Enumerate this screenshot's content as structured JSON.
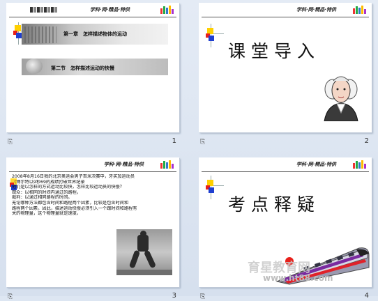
{
  "slides": [
    {
      "number": "1",
      "footer_icon": "⎘",
      "chapter_title": "第一章　怎样描述物体的运动",
      "section_title": "第二节　怎样描述运动的快慢"
    },
    {
      "number": "2",
      "footer_icon": "⎘",
      "title": "课堂导入",
      "image": "portrait-icon"
    },
    {
      "number": "3",
      "footer_icon": "⎘",
      "paragraph_lines": [
        "2008年8月16日我的北京奥运会男子百米决赛中，牙买加运动员",
        "（博尔特以9秒69的成绩打破世界纪录",
        "他们是以怎样的方式运动比较快，怎样比较运动员的快慢？",
        "观众：以相同的时间内通过的路程。",
        "裁判：以通过相同路程的时间。",
        "无论哪种方法都包含时间和路程两个因素，比较是包含时间和",
        "路程两个因素。因此，描述运动快慢必须引入一个跟时间和路程有",
        "关的物理量，这个物理量就是速度。"
      ],
      "image": "sprinter-photo"
    },
    {
      "number": "4",
      "footer_icon": "⎘",
      "title": "考点释疑",
      "image": "train-icon",
      "watermark_brand": "育星教育网",
      "watermark_url": "www.ht88.com"
    }
  ],
  "header_brand": "学科·网·精品·特供"
}
